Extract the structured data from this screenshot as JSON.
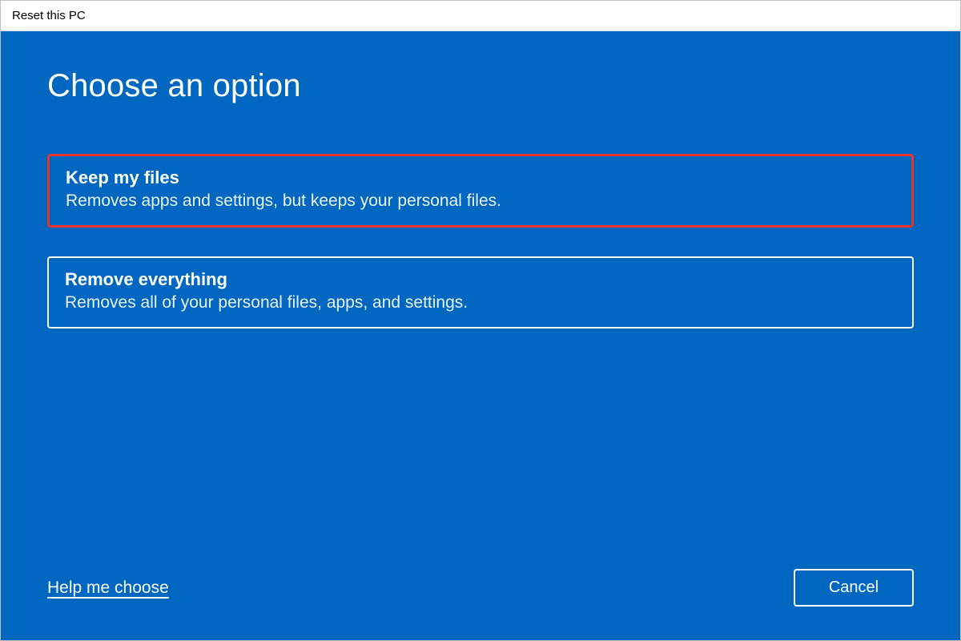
{
  "window": {
    "title": "Reset this PC"
  },
  "main": {
    "heading": "Choose an option",
    "options": [
      {
        "title": "Keep my files",
        "description": "Removes apps and settings, but keeps your personal files.",
        "highlighted": true
      },
      {
        "title": "Remove everything",
        "description": "Removes all of your personal files, apps, and settings.",
        "highlighted": false
      }
    ]
  },
  "footer": {
    "help_link": "Help me choose",
    "cancel_label": "Cancel"
  },
  "colors": {
    "accent": "#0067c0",
    "highlight_border": "#e8322c",
    "option_border": "#ffffff"
  }
}
